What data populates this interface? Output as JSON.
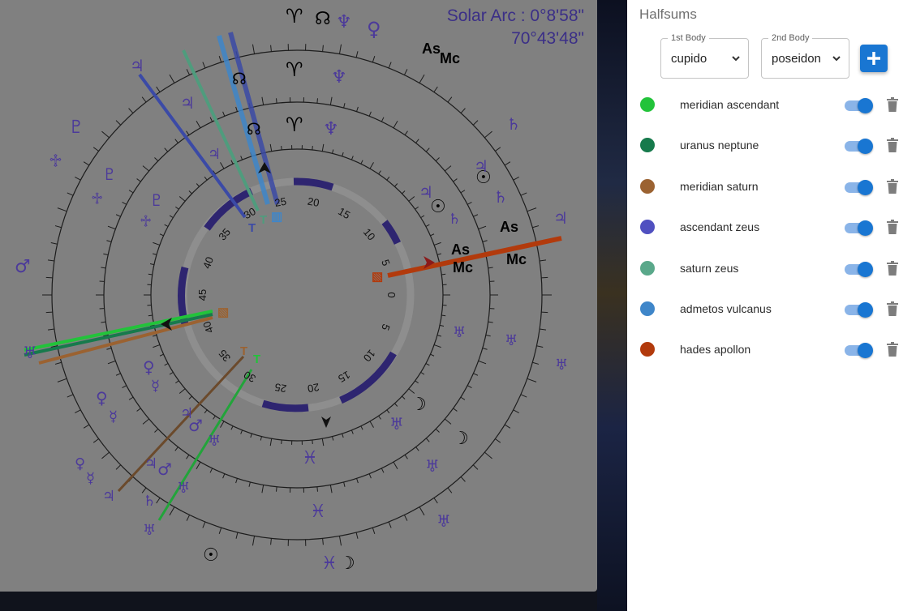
{
  "solar_arc": {
    "line1": "Solar Arc : 0°8'58\"",
    "line2": "70°43'48\""
  },
  "chart_labels": {
    "angles": [
      "As",
      "Mc"
    ],
    "inner_degree_ticks": [
      "20",
      "15",
      "10",
      "5",
      "0",
      "5",
      "10",
      "15",
      "20",
      "25",
      "30",
      "35",
      "40",
      "45",
      "40",
      "35",
      "30",
      "25"
    ]
  },
  "halfsums": {
    "title": "Halfsums",
    "first_body": {
      "legend": "1st Body",
      "value": "cupido"
    },
    "second_body": {
      "legend": "2nd Body",
      "value": "poseidon"
    },
    "add_icon": "plus-icon",
    "items": [
      {
        "label": "meridian ascendant",
        "color": "#22c33a",
        "enabled": true
      },
      {
        "label": "uranus neptune",
        "color": "#177a4c",
        "enabled": true
      },
      {
        "label": "meridian saturn",
        "color": "#9b6231",
        "enabled": true
      },
      {
        "label": "ascendant zeus",
        "color": "#5050c0",
        "enabled": true
      },
      {
        "label": "saturn zeus",
        "color": "#5aa88a",
        "enabled": true
      },
      {
        "label": "admetos vulcanus",
        "color": "#3f86c9",
        "enabled": true
      },
      {
        "label": "hades apollon",
        "color": "#b23a0c",
        "enabled": true
      }
    ]
  },
  "colors": {
    "glyph": "#4c3a9a",
    "ring_stroke": "#1c1c1c",
    "accent": "#1976d2"
  }
}
